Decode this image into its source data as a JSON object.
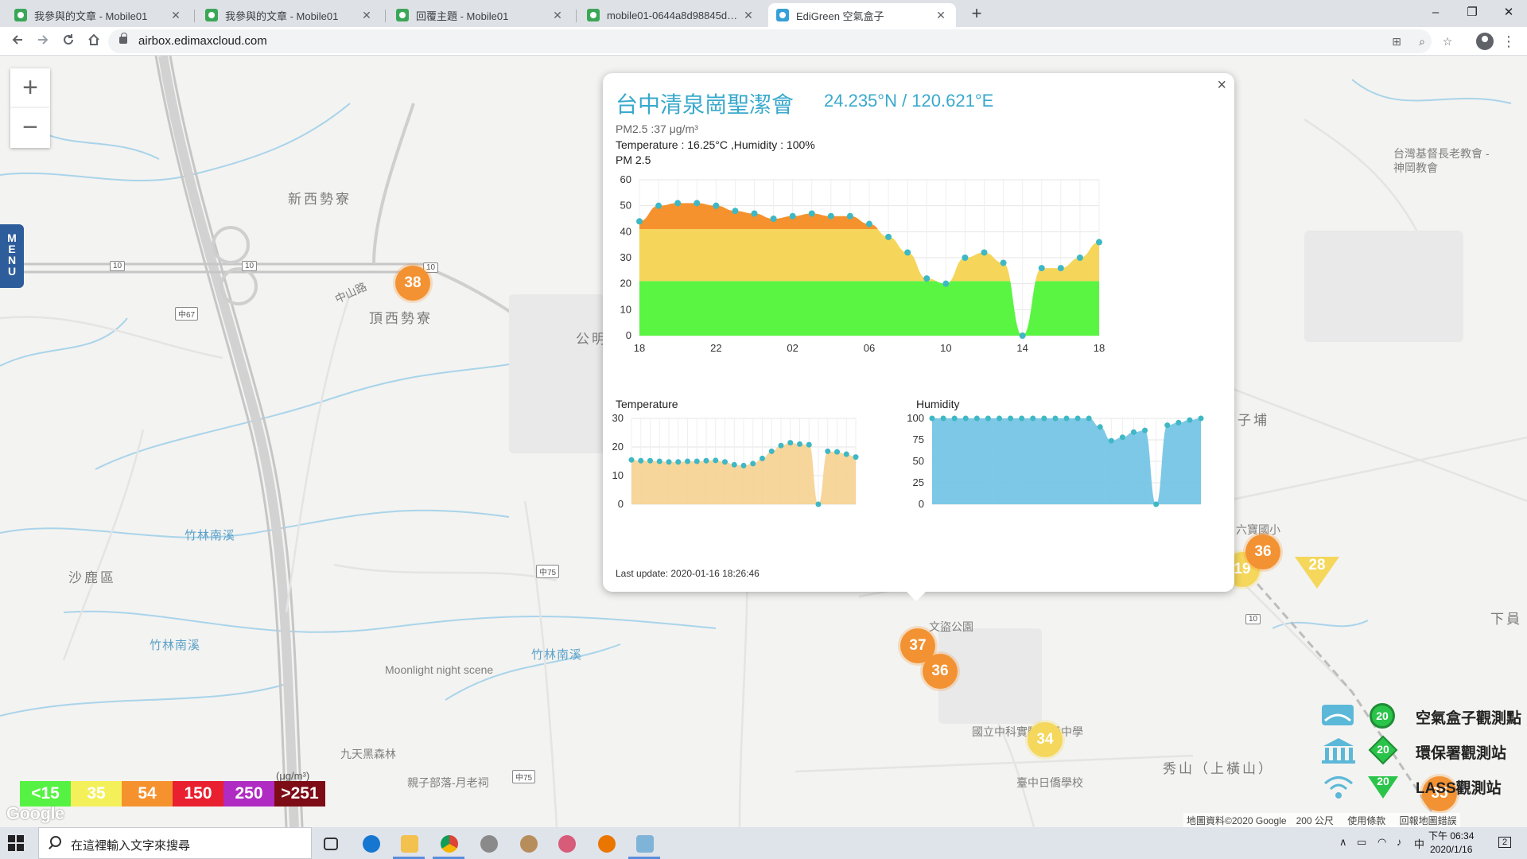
{
  "browser": {
    "tabs": [
      {
        "title": "我參與的文章 - Mobile01",
        "icon": "mobile01-favicon"
      },
      {
        "title": "我參與的文章 - Mobile01",
        "icon": "mobile01-favicon"
      },
      {
        "title": "回覆主題 - Mobile01",
        "icon": "mobile01-favicon"
      },
      {
        "title": "mobile01-0644a8d98845d2ba...",
        "icon": "mobile01-favicon"
      },
      {
        "title": "EdiGreen 空氣盒子",
        "icon": "edigreen-favicon",
        "active": true
      }
    ],
    "new_tab": "+",
    "url": "airbox.edimaxcloud.com",
    "window_controls": {
      "minimize": "–",
      "maximize": "❐",
      "close": "✕"
    }
  },
  "map": {
    "zoom_in": "+",
    "zoom_out": "−",
    "menu_label": [
      "M",
      "E",
      "N",
      "U"
    ],
    "place_labels": {
      "xinxi": "新西勢寮",
      "dingxi": "頂西勢寮",
      "shalu": "沙鹿區",
      "zhulin1": "竹林南溪",
      "zhulin2": "竹林南溪",
      "zhulin3": "竹林南溪",
      "moonlight": "Moonlight night scene",
      "jiutian": "九天黑森林",
      "qinzi": "親子部落-月老祠",
      "park": "文盜公園",
      "school": "國立中科實驗高級中學",
      "rixin": "臺中日僑學校",
      "xiushan": "秀山（上橫山）",
      "zikeng": "子埔",
      "church": "台灣基督長老教會 - 神岡教會",
      "liubao": "六寶國小",
      "xiaju": "下員",
      "gongming": "公明",
      "road_zhongshan": "中山路"
    },
    "markers": [
      {
        "value": "38",
        "level": "orange"
      },
      {
        "value": "36",
        "level": "orange"
      },
      {
        "value": "19",
        "level": "yellow"
      },
      {
        "value": "28",
        "level": "yellow"
      },
      {
        "value": "37",
        "level": "orange"
      },
      {
        "value": "36",
        "level": "orange"
      },
      {
        "value": "34",
        "level": "yellow"
      },
      {
        "value": "35",
        "level": "orange"
      }
    ],
    "legend": {
      "unit": "(μg/m³)",
      "segments": [
        {
          "label": "<15",
          "bg": "#56f243",
          "fg": "#ffffff"
        },
        {
          "label": "35",
          "bg": "#f4f05a",
          "fg": "#ffffff"
        },
        {
          "label": "54",
          "bg": "#f5922e",
          "fg": "#ffffff"
        },
        {
          "label": "150",
          "bg": "#e8202f",
          "fg": "#ffffff"
        },
        {
          "label": "250",
          "bg": "#b02bc2",
          "fg": "#ffffff"
        },
        {
          "label": ">251",
          "bg": "#7d0c16",
          "fg": "#ffffff"
        }
      ]
    },
    "station_types": [
      {
        "label": "空氣盒子觀測點",
        "value": "20"
      },
      {
        "label": "環保署觀測站",
        "value": "20"
      },
      {
        "label": "LASS觀測站",
        "value": "20"
      }
    ],
    "attribution": "地圖資料©2020 Google　200 公尺",
    "terms": "使用條款",
    "report": "回報地圖錯誤",
    "google": "Google"
  },
  "popup": {
    "close": "×",
    "title": "台中清泉崗聖潔會",
    "coords": "24.235°N / 120.621°E",
    "pm_line": "PM2.5 :37 μg/m³",
    "temp_line": "Temperature : 16.25°C ,Humidity : 100%",
    "pm_chart_label": "PM 2.5",
    "temp_chart_label": "Temperature",
    "hum_chart_label": "Humidity",
    "last_update": "Last update: 2020-01-16 18:26:46"
  },
  "chart_data": [
    {
      "type": "area",
      "title": "PM 2.5",
      "x_ticks": [
        "18",
        "22",
        "02",
        "06",
        "10",
        "14",
        "18"
      ],
      "ylim": [
        0,
        60
      ],
      "y_ticks": [
        0,
        10,
        20,
        30,
        40,
        50,
        60
      ],
      "grid": true,
      "series": [
        {
          "values": [
            44,
            50,
            51,
            51,
            50,
            48,
            47,
            45,
            46,
            47,
            46,
            46,
            43,
            38,
            32,
            22,
            20,
            30,
            32,
            28,
            0,
            26,
            26,
            30,
            36
          ]
        }
      ],
      "colors": {
        "green": "#5af542",
        "yellow": "#f5d65a",
        "orange": "#f5922e",
        "point": "#3eb8c4"
      }
    },
    {
      "type": "area",
      "title": "Temperature",
      "ylim": [
        0,
        30
      ],
      "y_ticks": [
        0,
        10,
        20,
        30
      ],
      "grid": true,
      "series": [
        {
          "values": [
            15.5,
            15.2,
            15.2,
            15,
            14.8,
            14.8,
            15,
            15,
            15.2,
            15.3,
            14.8,
            13.8,
            13.5,
            14.2,
            16,
            18.5,
            20.5,
            21.5,
            21,
            20.8,
            0,
            18.5,
            18.3,
            17.5,
            16.5
          ]
        }
      ],
      "colors": {
        "fill": "#f6cf8b",
        "point": "#3eb8c4"
      }
    },
    {
      "type": "area",
      "title": "Humidity",
      "ylim": [
        0,
        100
      ],
      "y_ticks": [
        0,
        25,
        50,
        75,
        100
      ],
      "grid": true,
      "series": [
        {
          "values": [
            100,
            100,
            100,
            100,
            100,
            100,
            100,
            100,
            100,
            100,
            100,
            100,
            100,
            100,
            100,
            90,
            74,
            78,
            84,
            86,
            0,
            92,
            95,
            98,
            100
          ]
        }
      ],
      "colors": {
        "fill": "#6fc2e3",
        "point": "#3eb8c4"
      }
    }
  ],
  "taskbar": {
    "search_placeholder": "在這裡輸入文字來搜尋",
    "time": "下午 06:34",
    "date": "2020/1/16",
    "ime": "中",
    "notifications": "2"
  }
}
